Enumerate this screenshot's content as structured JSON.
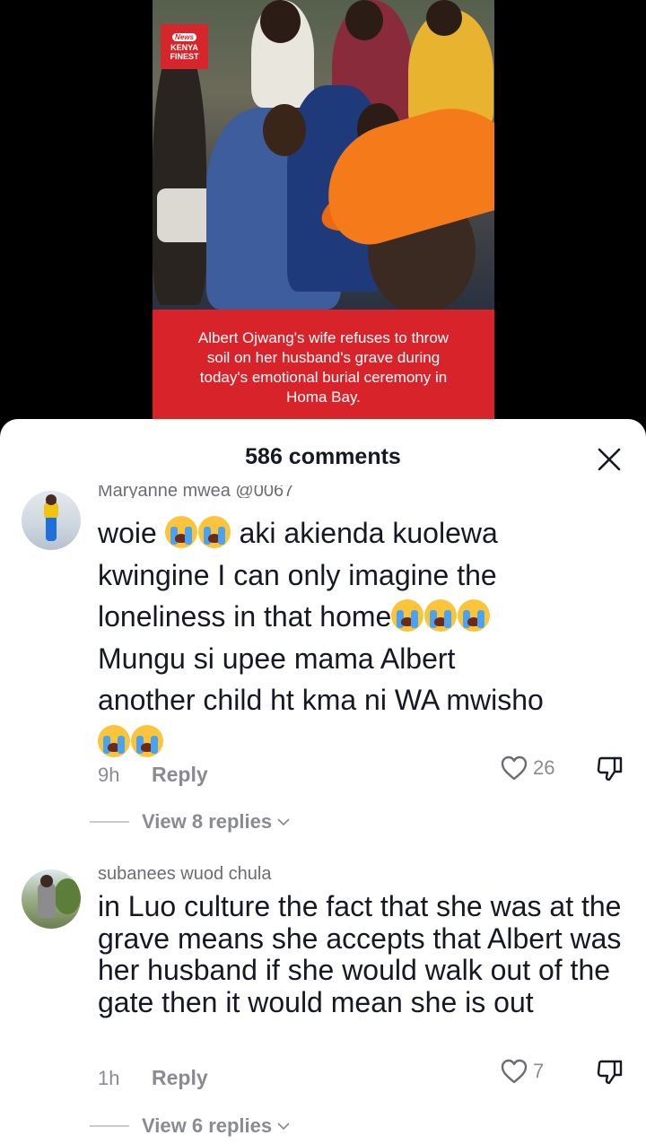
{
  "video": {
    "logo_badge": "News",
    "logo_line1": "KENYA",
    "logo_line2": "FINEST",
    "caption": "Albert Ojwang's wife refuses to throw soil on her husband's grave during today's emotional burial ceremony in Homa Bay."
  },
  "sheet": {
    "title": "586 comments"
  },
  "comments": [
    {
      "username": "Maryanne mwea @0067",
      "line1_a": "woie",
      "line1_b": "aki akienda kuolewa",
      "line2": "kwingine I can only imagine the",
      "line3": "loneliness in that home",
      "line4": "Mungu si upee mama Albert",
      "line5": "another child ht kma ni WA mwisho",
      "time": "9h",
      "reply_label": "Reply",
      "likes": "26",
      "view_replies": "View 8 replies"
    },
    {
      "username": "subanees wuod chula",
      "text": "in Luo culture the fact that she was at the grave means she accepts that Albert was her husband if she would walk out of the gate then it would mean she is out",
      "time": "1h",
      "reply_label": "Reply",
      "likes": "7",
      "view_replies": "View 6 replies"
    }
  ],
  "icons": {
    "close": "close-icon",
    "like": "heart-outline-icon",
    "dislike": "thumbs-down-icon",
    "emoji": "loudly-crying-face-emoji",
    "chevron": "chevron-down-icon"
  },
  "colors": {
    "accent_red": "#d8232a",
    "cap_orange": "#f47a1a",
    "text_primary": "#161823",
    "text_secondary": "#8a8b91"
  }
}
